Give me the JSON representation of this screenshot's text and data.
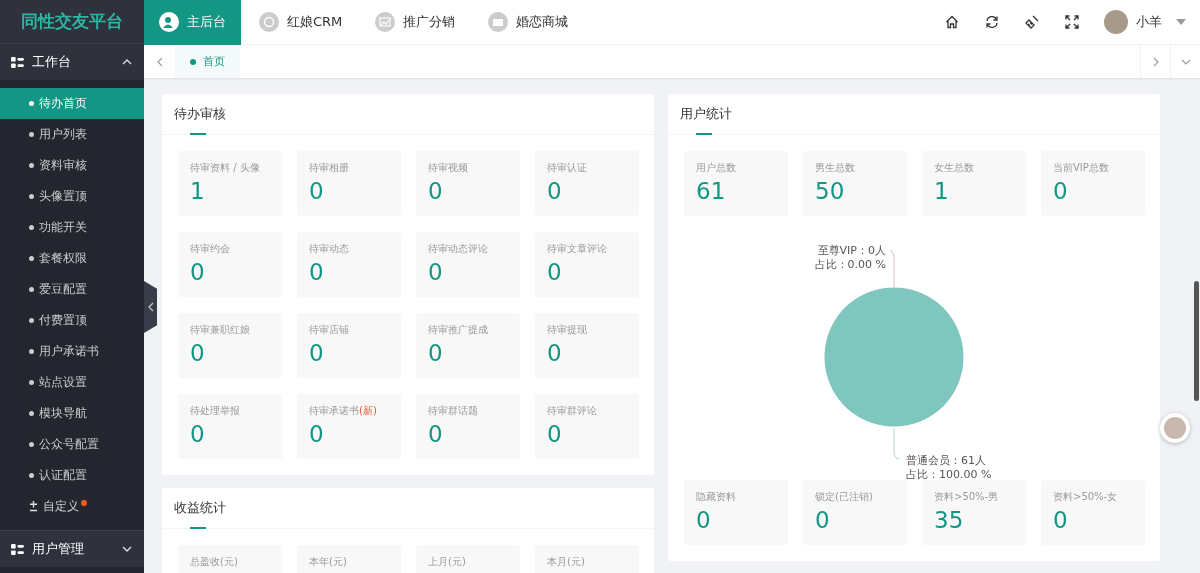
{
  "logo": "同性交友平台",
  "top_nav": [
    {
      "label": "主后台",
      "selected": true,
      "kind": "user"
    },
    {
      "label": "红娘CRM",
      "selected": false,
      "kind": "crm"
    },
    {
      "label": "推广分销",
      "selected": false,
      "kind": "image"
    },
    {
      "label": "婚恋商城",
      "selected": false,
      "kind": "shop"
    }
  ],
  "user": {
    "name": "小羊"
  },
  "page_tabs": [
    {
      "label": "首页",
      "selected": true
    }
  ],
  "sidebar": {
    "groups": [
      {
        "label": "工作台",
        "expanded": true,
        "items": [
          {
            "label": "待办首页",
            "selected": true,
            "kind": "dot",
            "badge": false
          },
          {
            "label": "用户列表",
            "selected": false,
            "kind": "dot",
            "badge": false
          },
          {
            "label": "资料审核",
            "selected": false,
            "kind": "dot",
            "badge": false
          },
          {
            "label": "头像置顶",
            "selected": false,
            "kind": "dot",
            "badge": false
          },
          {
            "label": "功能开关",
            "selected": false,
            "kind": "dot",
            "badge": false
          },
          {
            "label": "套餐权限",
            "selected": false,
            "kind": "dot",
            "badge": false
          },
          {
            "label": "爱豆配置",
            "selected": false,
            "kind": "dot",
            "badge": false
          },
          {
            "label": "付费置顶",
            "selected": false,
            "kind": "dot",
            "badge": false
          },
          {
            "label": "用户承诺书",
            "selected": false,
            "kind": "dot",
            "badge": false
          },
          {
            "label": "站点设置",
            "selected": false,
            "kind": "dot",
            "badge": false
          },
          {
            "label": "模块导航",
            "selected": false,
            "kind": "dot",
            "badge": false
          },
          {
            "label": "公众号配置",
            "selected": false,
            "kind": "dot",
            "badge": false
          },
          {
            "label": "认证配置",
            "selected": false,
            "kind": "dot",
            "badge": false
          },
          {
            "label": "自定义",
            "selected": false,
            "kind": "plus-minus",
            "badge": true
          }
        ]
      },
      {
        "label": "用户管理",
        "expanded": false
      }
    ]
  },
  "pending": {
    "title": "待办审核",
    "tiles": [
      {
        "label": "待审资料 / 头像",
        "value": "1"
      },
      {
        "label": "待审相册",
        "value": "0"
      },
      {
        "label": "待审视频",
        "value": "0"
      },
      {
        "label": "待审认证",
        "value": "0"
      },
      {
        "label": "待审约会",
        "value": "0"
      },
      {
        "label": "待审动态",
        "value": "0"
      },
      {
        "label": "待审动态评论",
        "value": "0"
      },
      {
        "label": "待审文章评论",
        "value": "0"
      },
      {
        "label": "待审兼职红娘",
        "value": "0"
      },
      {
        "label": "待审店铺",
        "value": "0"
      },
      {
        "label": "待审推广提成",
        "value": "0"
      },
      {
        "label": "待审提现",
        "value": "0"
      },
      {
        "label": "待处理举报",
        "value": "0"
      },
      {
        "label": "待审承诺书",
        "note": "(新)",
        "value": "0"
      },
      {
        "label": "待审群话题",
        "value": "0"
      },
      {
        "label": "待审群评论",
        "value": "0"
      }
    ]
  },
  "income": {
    "title": "收益统计",
    "tiles": [
      {
        "label": "总盈收(元)"
      },
      {
        "label": "本年(元)"
      },
      {
        "label": "上月(元)"
      },
      {
        "label": "本月(元)"
      }
    ]
  },
  "users": {
    "title": "用户统计",
    "top_tiles": [
      {
        "label": "用户总数",
        "value": "61"
      },
      {
        "label": "男生总数",
        "value": "50"
      },
      {
        "label": "女生总数",
        "value": "1"
      },
      {
        "label": "当前VIP总数",
        "value": "0"
      }
    ],
    "chart_data": {
      "type": "pie",
      "series": [
        {
          "color": "#7ec6be",
          "values": [
            0,
            100
          ]
        }
      ],
      "value_labels": [
        [
          "至尊VIP：0人",
          "占比：0.00 %"
        ],
        [
          "普通会员：61人",
          "占比：100.00 %"
        ]
      ]
    },
    "bottom_tiles": [
      {
        "label": "隐藏资料",
        "value": "0"
      },
      {
        "label": "锁定(已注销)",
        "value": "0"
      },
      {
        "label": "资料>50%-男",
        "value": "35"
      },
      {
        "label": "资料>50%-女",
        "value": "0"
      }
    ]
  }
}
